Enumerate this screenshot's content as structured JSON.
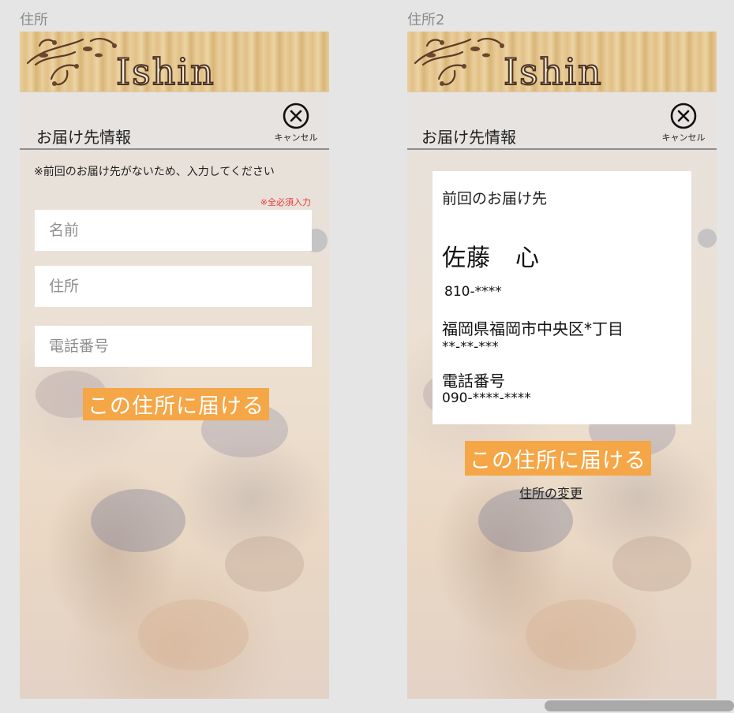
{
  "artboards": {
    "left_label": "住所",
    "right_label": "住所2"
  },
  "app": {
    "logo_text": "Ishin"
  },
  "screen1": {
    "title": "お届け先情報",
    "cancel_label": "キャンセル",
    "notice": "※前回のお届け先がないため、入力してください",
    "required_note": "※全必須入力",
    "fields": {
      "name_placeholder": "名前",
      "address_placeholder": "住所",
      "phone_placeholder": "電話番号"
    },
    "submit_label": "この住所に届ける"
  },
  "screen2": {
    "title": "お届け先情報",
    "cancel_label": "キャンセル",
    "card": {
      "heading": "前回のお届け先",
      "name": "佐藤　心",
      "postal_code": "810-****",
      "address_line1": "福岡県福岡市中央区*丁目",
      "address_line2": "**-**-***",
      "phone_label": "電話番号",
      "phone": "090-****-****"
    },
    "submit_label": "この住所に届ける",
    "change_link": "住所の変更"
  },
  "colors": {
    "accent": "#f5a646",
    "required": "#e53c3c",
    "divider": "#8f8f8f"
  },
  "icons": {
    "cancel": "close-circle-icon",
    "ornament": "floral-ornament-icon"
  }
}
